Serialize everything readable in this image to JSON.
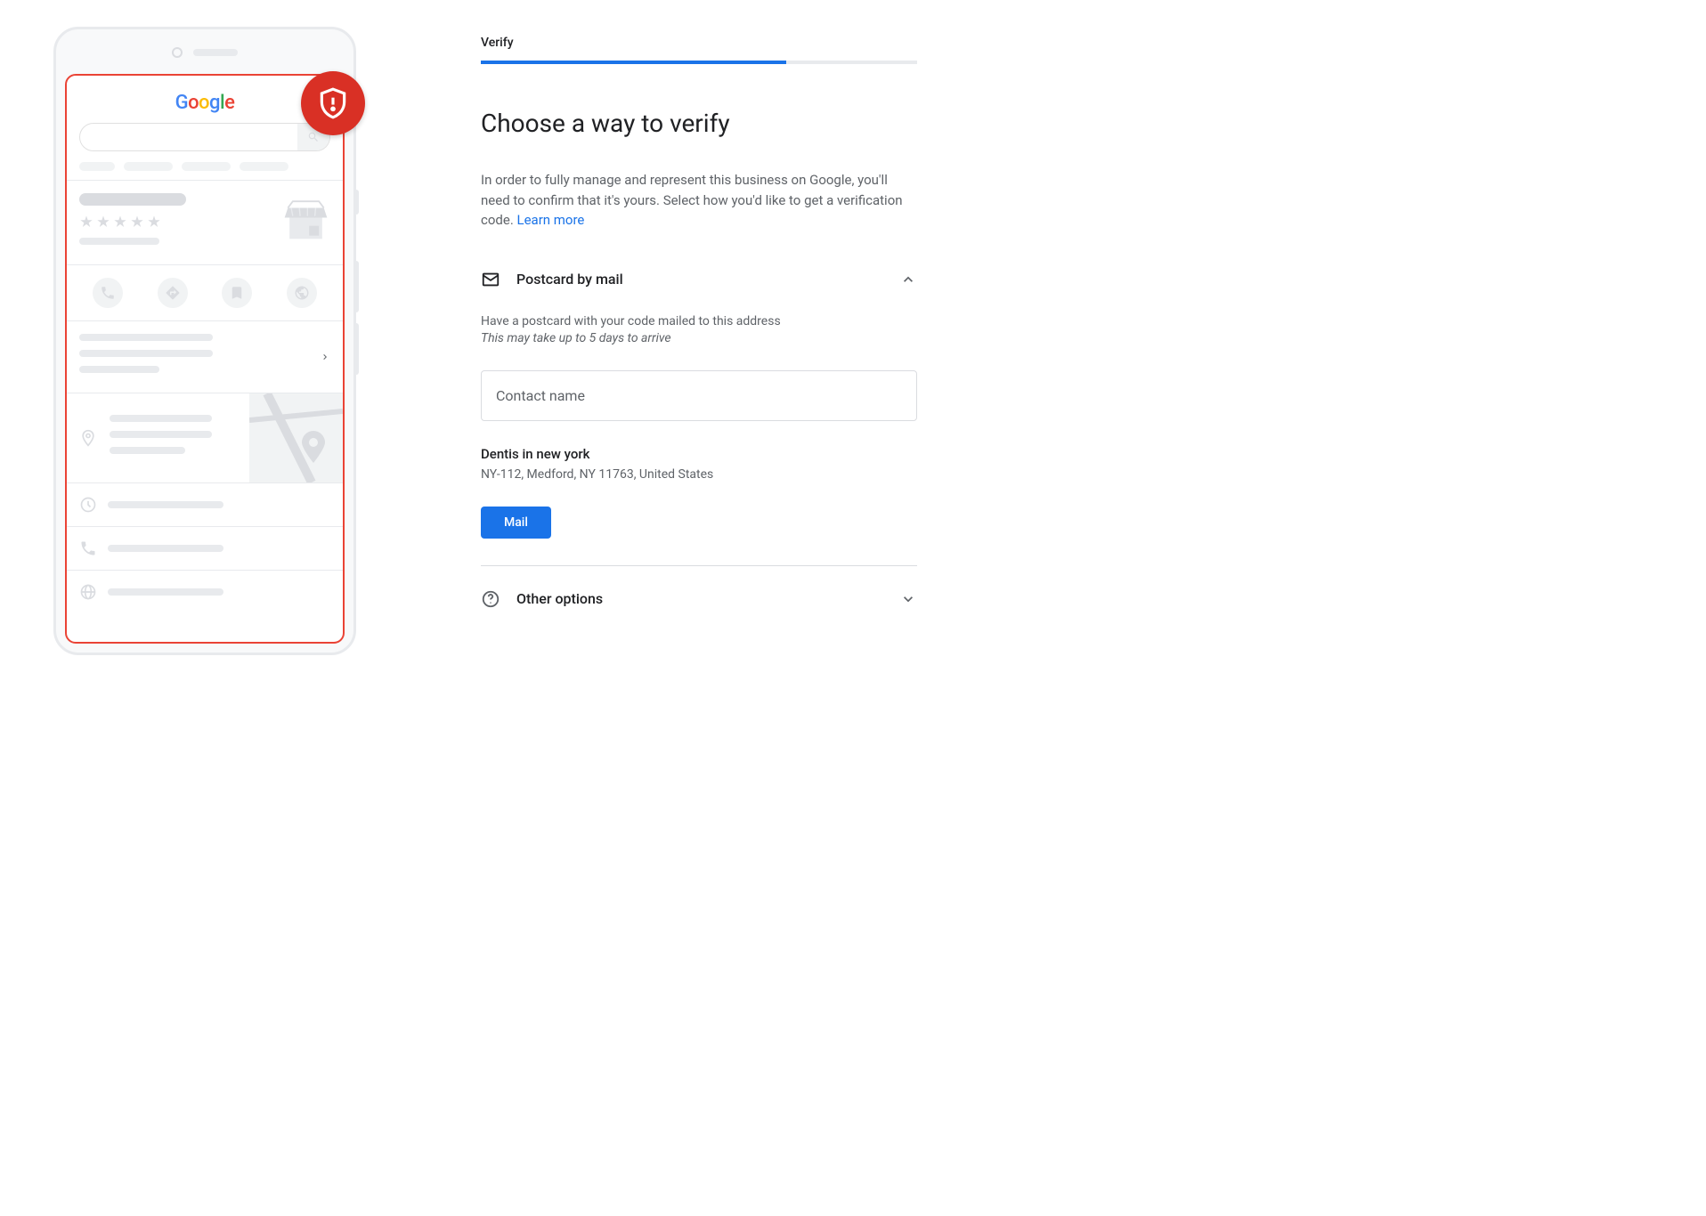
{
  "illustration": {
    "logo_text": "Google"
  },
  "step": {
    "label": "Verify",
    "progress_percent": 70
  },
  "heading": "Choose a way to verify",
  "description": "In order to fully manage and represent this business on Google, you'll need to confirm that it's yours. Select how you'd like to get a verification code. ",
  "learn_more": "Learn more",
  "postcard": {
    "title": "Postcard by mail",
    "subtitle": "Have a postcard with your code mailed to this address",
    "note": "This may take up to 5 days to arrive",
    "contact_placeholder": "Contact name",
    "contact_value": "",
    "business_name": "Dentis in new york",
    "business_address": "NY-112, Medford, NY 11763, United States",
    "button": "Mail"
  },
  "other_options": {
    "title": "Other options"
  }
}
